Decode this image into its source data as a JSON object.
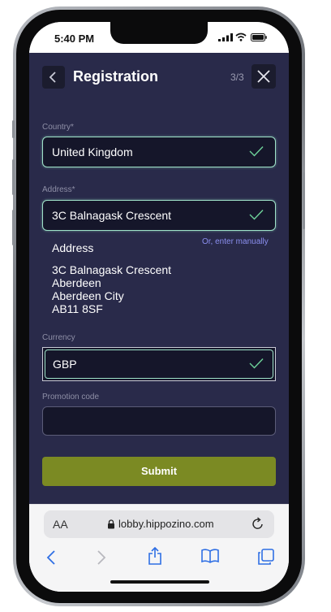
{
  "status": {
    "time": "5:40 PM"
  },
  "header": {
    "title": "Registration",
    "step": "3/3",
    "back_icon": "chevron-left-icon",
    "close_icon": "close-icon"
  },
  "form": {
    "country": {
      "label": "Country*",
      "value": "United Kingdom"
    },
    "address": {
      "label": "Address*",
      "value": "3C Balnagask Crescent",
      "enter_manually": "Or, enter manually",
      "summary_heading": "Address",
      "lines": [
        "3C Balnagask Crescent",
        "Aberdeen",
        "Aberdeen City",
        "AB11 8SF"
      ]
    },
    "currency": {
      "label": "Currency",
      "value": "GBP"
    },
    "promotion": {
      "label": "Promotion code",
      "value": ""
    },
    "submit_label": "Submit"
  },
  "browser": {
    "text_size_label": "AA",
    "url": "lobby.hippozino.com"
  },
  "colors": {
    "app_bg": "#292a4a",
    "field_bg": "#15162a",
    "valid_border": "#9fe3c9",
    "check": "#6ed29a",
    "submit_bg": "#7b8a23",
    "link": "#8b8ff0"
  }
}
